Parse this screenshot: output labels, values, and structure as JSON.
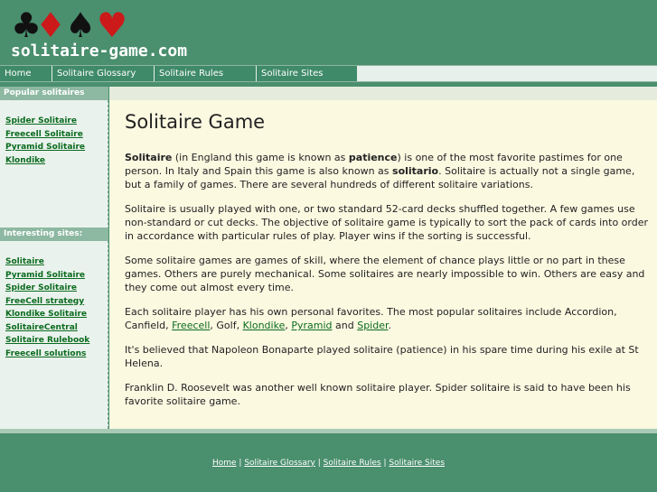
{
  "site": {
    "logo_text": "solitaire-game.com",
    "suits": [
      {
        "name": "club-icon",
        "glyph": "♣",
        "color": "#111111"
      },
      {
        "name": "diamond-icon",
        "glyph": "♦",
        "color": "#cc1a1a"
      },
      {
        "name": "spade-icon",
        "glyph": "♠",
        "color": "#111111"
      },
      {
        "name": "heart-icon",
        "glyph": "♥",
        "color": "#cc1a1a"
      }
    ]
  },
  "nav": {
    "items": [
      "Home",
      "Solitaire Glossary",
      "Solitaire Rules",
      "Solitaire Sites"
    ]
  },
  "sidebar": {
    "popular_heading": "Popular solitaires",
    "popular_links": [
      "Spider Solitaire",
      "Freecell Solitaire",
      "Pyramid Solitaire",
      "Klondike"
    ],
    "interesting_heading": "Interesting sites:",
    "interesting_links": [
      "Solitaire",
      "Pyramid Solitaire",
      "Spider Solitaire",
      "FreeCell strategy",
      "Klondike Solitaire",
      "SolitaireCentral",
      "Solitaire Rulebook",
      "Freecell solutions"
    ]
  },
  "main": {
    "title": "Solitaire Game",
    "p1": {
      "b1": "Solitaire",
      "t1": " (in England this game is known as ",
      "b2": "patience",
      "t2": ") is one of the most favorite pastimes for one person. In Italy and Spain this game is also known as ",
      "b3": "solitario",
      "t3": ". Solitaire is actually not a single game, but a family of games. There are several hundreds of different solitaire variations."
    },
    "p2": "Solitaire is usually played with one, or two standard 52-card decks shuffled together. A few games use non-standard or cut decks. The objective of solitaire game is typically to sort the pack of cards into order in accordance with particular rules of play. Player wins if the sorting is successful.",
    "p3": "Some solitaire games are games of skill, where the element of chance plays little or no part in these games. Others are purely mechanical. Some solitaires are nearly impossible to win. Others are easy and they come out almost every time.",
    "p4": {
      "t1": "Each solitaire player has his own personal favorites. The most popular solitaires include Accordion, Canfield, ",
      "l1": "Freecell",
      "t2": ", Golf, ",
      "l2": "Klondike",
      "t3": ", ",
      "l3": "Pyramid",
      "t4": " and ",
      "l4": "Spider",
      "t5": "."
    },
    "p5": "It's believed that Napoleon Bonaparte played solitaire (patience) in his spare time during his exile at St Helena.",
    "p6": "Franklin D. Roosevelt was another well known solitaire player. Spider solitaire is said to have been his favorite solitaire game."
  },
  "footer": {
    "links": [
      "Home",
      "Solitaire Glossary",
      "Solitaire Rules",
      "Solitaire Sites"
    ],
    "separator": " | "
  }
}
